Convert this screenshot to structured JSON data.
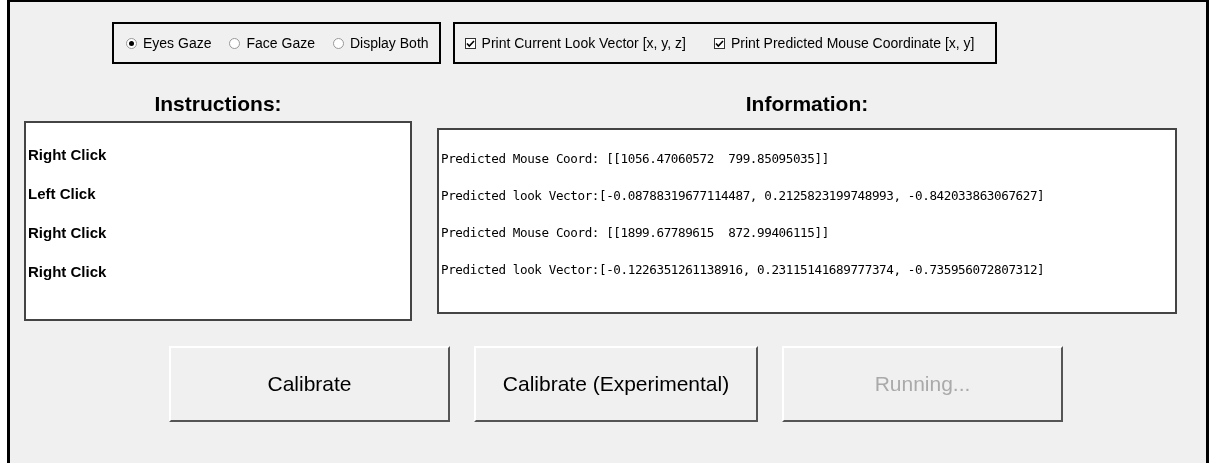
{
  "view_modes": [
    {
      "label": "Eyes Gaze",
      "selected": true
    },
    {
      "label": "Face Gaze",
      "selected": false
    },
    {
      "label": "Display Both",
      "selected": false
    }
  ],
  "print_options": [
    {
      "label": "Print Current Look Vector [x, y, z]",
      "checked": true
    },
    {
      "label": "Print Predicted Mouse Coordinate [x, y]",
      "checked": true
    }
  ],
  "instructions": {
    "heading": "Instructions:",
    "lines": [
      "Right Click",
      "Left Click",
      "Right Click",
      "Right Click"
    ]
  },
  "information": {
    "heading": "Information:",
    "lines": [
      "Predicted Mouse Coord: [[1056.47060572  799.85095035]]",
      "Predicted look Vector:[-0.08788319677114487, 0.2125823199748993, -0.842033863067627]",
      "Predicted Mouse Coord: [[1899.67789615  872.99406115]]",
      "Predicted look Vector:[-0.1226351261138916, 0.23115141689777374, -0.735956072807312]"
    ]
  },
  "buttons": [
    {
      "label": "Calibrate",
      "disabled": false
    },
    {
      "label": "Calibrate (Experimental)",
      "disabled": false
    },
    {
      "label": "Running...",
      "disabled": true
    }
  ]
}
